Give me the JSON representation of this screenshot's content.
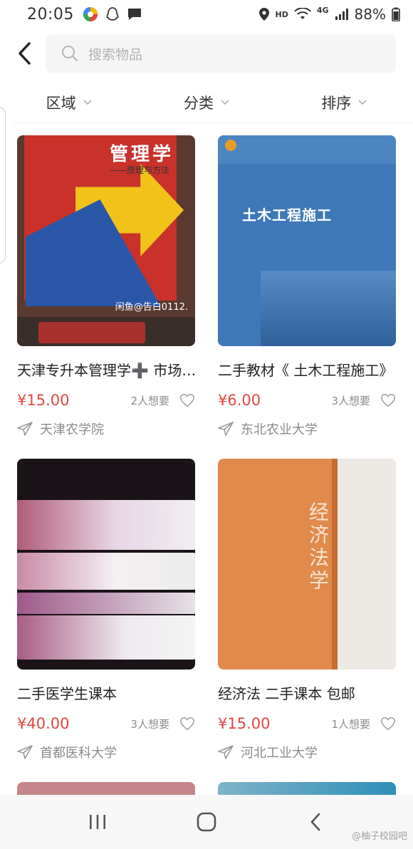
{
  "status_bar": {
    "time": "20:05",
    "hd": "HD",
    "network": "4G",
    "battery": "88%"
  },
  "search": {
    "placeholder": "搜索物品"
  },
  "filters": [
    {
      "label": "区域"
    },
    {
      "label": "分类"
    },
    {
      "label": "排序"
    }
  ],
  "products": [
    {
      "title": "天津专升本管理学➕ 市场营销",
      "price": "¥15.00",
      "wants": "2人想要",
      "school": "天津农学院",
      "cover_text": {
        "title": "管理学",
        "subtitle": "——原理与方法",
        "watermark": "闲鱼@告白0112."
      }
    },
    {
      "title": "二手教材《 土木工程施工》",
      "price": "¥6.00",
      "wants": "3人想要",
      "school": "东北农业大学",
      "cover_text": {
        "title": "土木工程施工"
      }
    },
    {
      "title": "二手医学生课本",
      "price": "¥40.00",
      "wants": "3人想要",
      "school": "首都医科大学"
    },
    {
      "title": "经济法 二手课本 包邮",
      "price": "¥15.00",
      "wants": "1人想要",
      "school": "河北工业大学",
      "cover_text": {
        "title": "经济法学"
      }
    }
  ],
  "watermark": "@柚子校园吧",
  "colors": {
    "price": "#e2463f",
    "search_bg": "#f5f5f5",
    "nav_bg": "#f7f7f7"
  }
}
